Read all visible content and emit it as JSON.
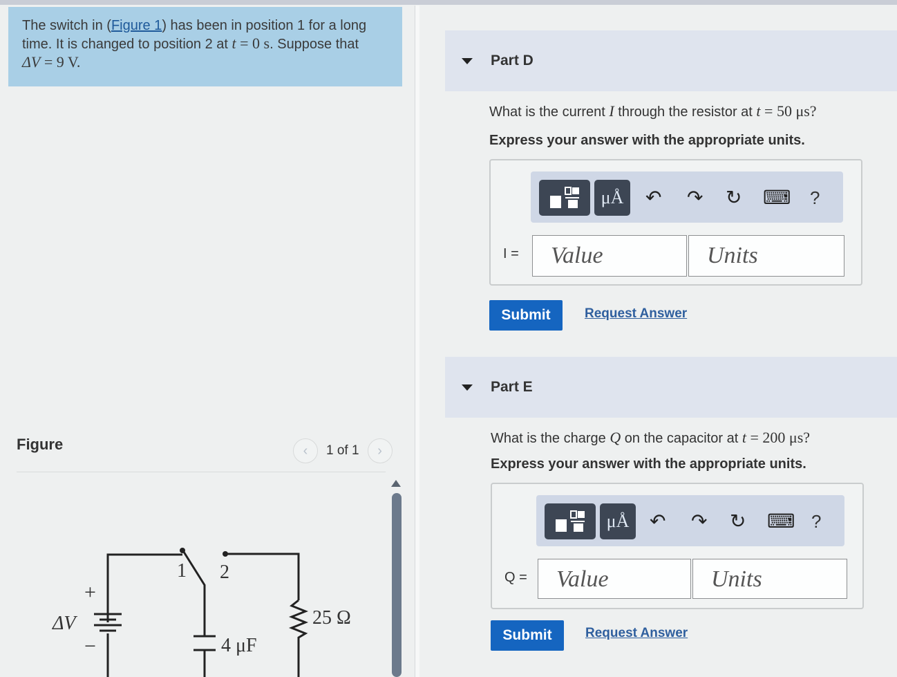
{
  "problem": {
    "text_before_link": "The switch in (",
    "link": "Figure 1",
    "text_after_link": ") has been in position 1 for a long time. It is changed to position 2 at ",
    "t_var": "t",
    "eq_zero": " = 0 s",
    "text_end": ". Suppose that",
    "delta_v": "ΔV",
    "delta_v_value": " = 9 V."
  },
  "figure": {
    "title": "Figure",
    "page": "1 of 1",
    "prev_icon": "‹",
    "next_icon": "›",
    "labels": {
      "pos1": "1",
      "pos2": "2",
      "plus": "+",
      "minus": "−",
      "source": "ΔV",
      "capacitor": "4 μF",
      "resistor": "25 Ω"
    }
  },
  "parts": [
    {
      "title": "Part D",
      "q_prefix": "What is the current ",
      "q_var": "I",
      "q_mid": " through the resistor at ",
      "q_t": "t",
      "q_value": " = 50 μs?",
      "instruction": "Express your answer with the appropriate units.",
      "answer_label": "I =",
      "value_placeholder": "Value",
      "units_placeholder": "Units",
      "submit": "Submit",
      "request": "Request Answer"
    },
    {
      "title": "Part E",
      "q_prefix": "What is the charge ",
      "q_var": "Q",
      "q_mid": " on the capacitor at ",
      "q_t": "t",
      "q_value": " = 200 μs?",
      "instruction": "Express your answer with the appropriate units.",
      "answer_label": "Q =",
      "value_placeholder": "Value",
      "units_placeholder": "Units",
      "submit": "Submit",
      "request": "Request Answer"
    }
  ],
  "toolbar": {
    "units_button": "μÅ",
    "undo_icon": "↶",
    "redo_icon": "↷",
    "reset_icon": "↻",
    "keyboard_icon": "⌨",
    "help_icon": "?"
  }
}
